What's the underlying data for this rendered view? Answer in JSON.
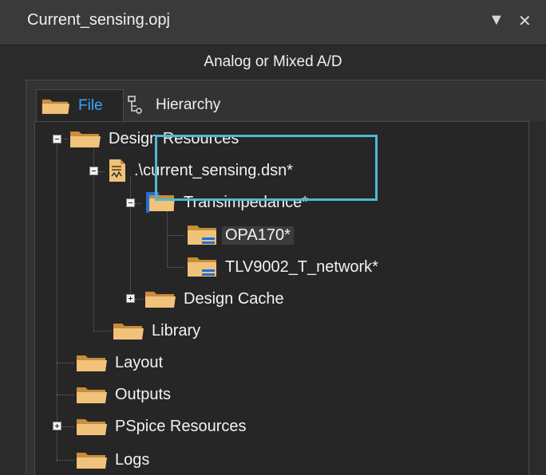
{
  "window": {
    "title": "Current_sensing.opj",
    "dropdown_glyph": "▼",
    "close_glyph": "✕"
  },
  "mode": "Analog or Mixed A/D",
  "tabs": [
    {
      "label": "File",
      "icon": "folder-icon",
      "active": true
    },
    {
      "label": "Hierarchy",
      "icon": "hierarchy-icon",
      "active": false
    }
  ],
  "tree": {
    "design_resources": "Design Resources",
    "design_file": ".\\current_sensing.dsn*",
    "schematic": "Transimpedance*",
    "pages": [
      "OPA170*",
      "TLV9002_T_network*"
    ],
    "design_cache": "Design Cache",
    "library": "Library",
    "layout": "Layout",
    "outputs": "Outputs",
    "pspice_resources": "PSpice Resources",
    "logs": "Logs"
  },
  "colors": {
    "accent": "#3da2ff",
    "highlight_box": "#4fb8d6",
    "folder": "#e8b86a",
    "page_blue": "#1e6fd8"
  }
}
